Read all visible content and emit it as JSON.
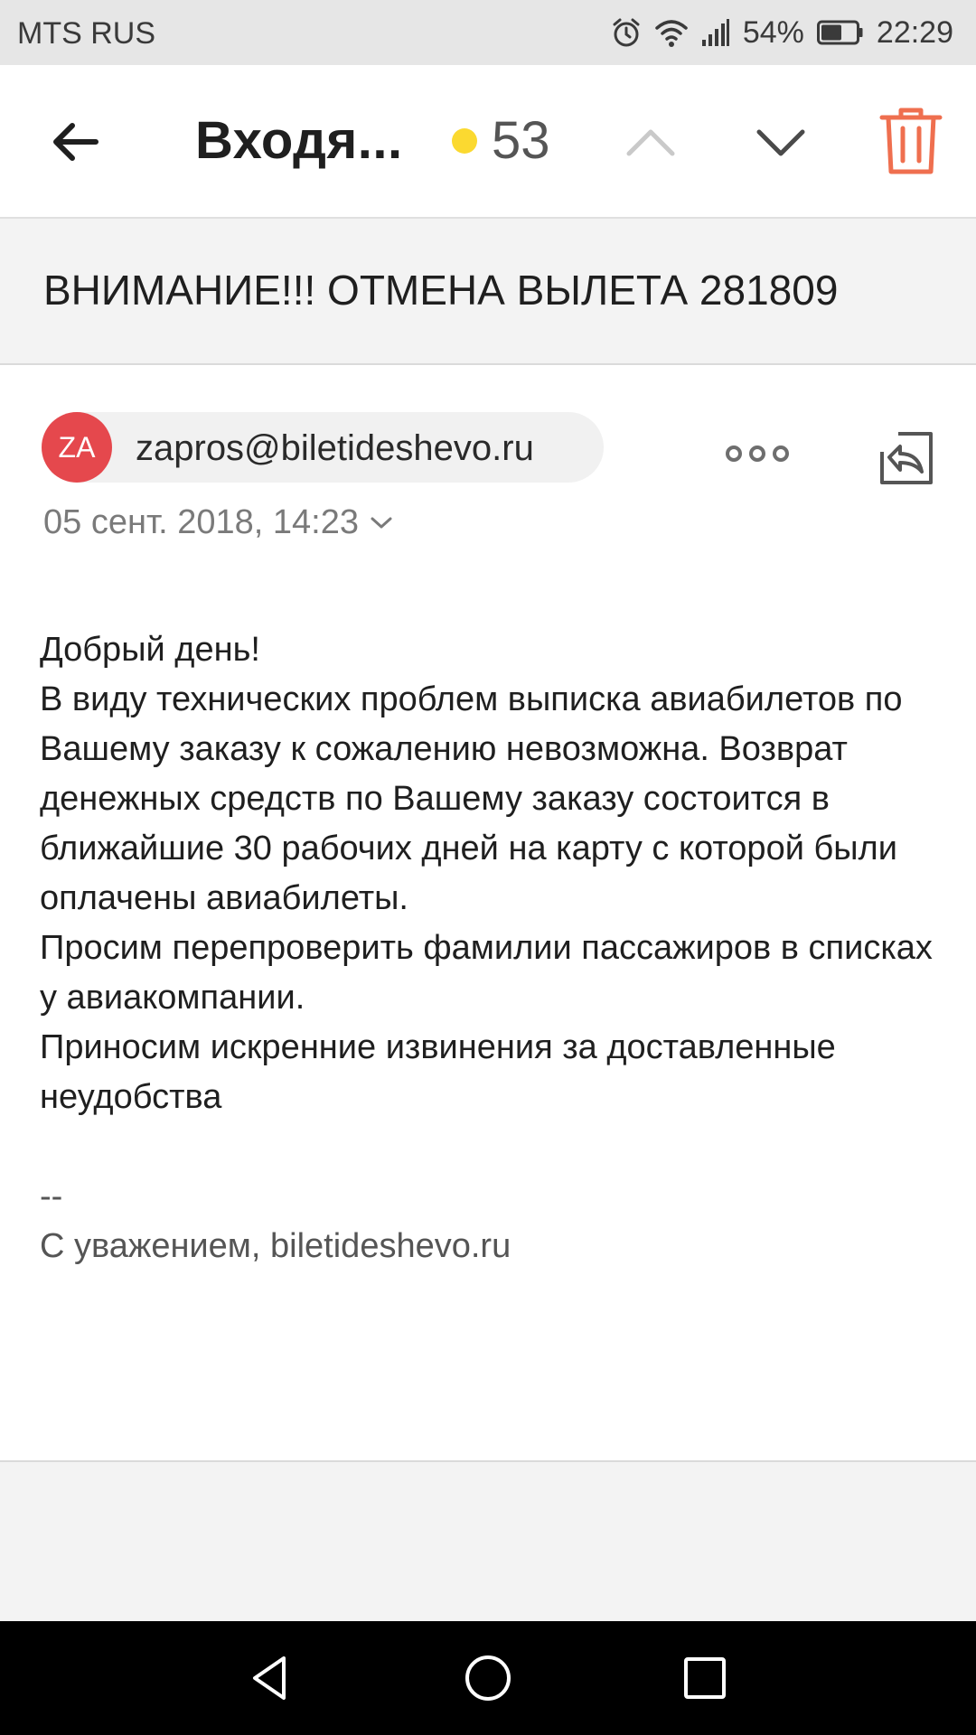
{
  "status_bar": {
    "carrier": "MTS RUS",
    "battery": "54%",
    "time": "22:29",
    "icons": [
      "alarm-icon",
      "wifi-icon",
      "signal-icon",
      "battery-icon"
    ]
  },
  "toolbar": {
    "folder_title": "Входя...",
    "unread_count": "53",
    "unread_dot_color": "#fbd930",
    "icons": [
      "back-arrow-icon",
      "chevron-up-icon",
      "chevron-down-icon",
      "trash-icon"
    ],
    "trash_color": "#ef6f4f"
  },
  "message": {
    "subject": "ВНИМАНИЕ!!! ОТМЕНА ВЫЛЕТА 281809",
    "sender": {
      "initials": "ZA",
      "email": "zapros@biletideshevo.ru",
      "avatar_color": "#e5484d"
    },
    "date": "05 сент. 2018, 14:23",
    "body": {
      "greeting": "Добрый день!",
      "paragraph1": "В виду технических проблем выписка авиабилетов по Вашему заказу к сожалению невозможна. Возврат денежных средств по Вашему заказу состоится в ближайшие 30 рабочих дней на карту с которой были оплачены авиабилеты.",
      "paragraph2": "Просим перепроверить фамилии пассажиров в списках у авиакомпании.",
      "paragraph3": "Приносим искренние извинения за доставленные неудобства",
      "separator": "--",
      "signature": "С уважением, biletideshevo.ru"
    }
  },
  "nav_bar": {
    "icons": [
      "nav-back-icon",
      "nav-home-icon",
      "nav-recents-icon"
    ]
  }
}
